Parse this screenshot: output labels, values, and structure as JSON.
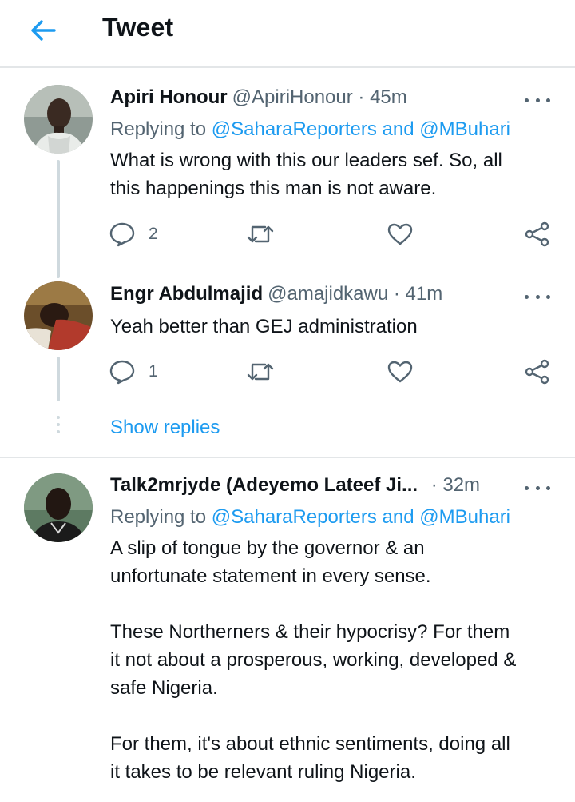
{
  "header": {
    "title": "Tweet",
    "back_icon": "arrow-left-icon"
  },
  "accent_color": "#1d9bf0",
  "tweets": [
    {
      "name": "Apiri Honour",
      "handle": "@ApiriHonour",
      "time": "· 45m",
      "replying_prefix": "Replying to ",
      "replying_mention1": "@SaharaReporters",
      "replying_and": " and ",
      "replying_mention2": "@MBuhari",
      "text_lines": [
        "What is wrong with this our leaders sef. So, all",
        "this happenings this man is not aware."
      ],
      "reply_count": "2"
    },
    {
      "name": "Engr Abdulmajid",
      "handle": "@amajidkawu",
      "time": "· 41m",
      "text_lines": [
        "Yeah better than GEJ administration"
      ],
      "reply_count": "1"
    },
    {
      "name": "Talk2mrjyde (Adeyemo Lateef Ji...",
      "handle": "",
      "time": "· 32m",
      "replying_prefix": "Replying to ",
      "replying_mention1": "@SaharaReporters",
      "replying_and": " and ",
      "replying_mention2": "@MBuhari",
      "paragraphs": [
        [
          "A slip of tongue by the governor & an",
          "unfortunate statement in every sense."
        ],
        [
          "These Northerners & their hypocrisy? For them",
          "it not about a prosperous, working, developed &",
          "safe Nigeria."
        ],
        [
          "For them, it's about ethnic sentiments, doing all",
          "it takes to be relevant ruling Nigeria."
        ]
      ]
    }
  ],
  "show_replies": "Show replies"
}
